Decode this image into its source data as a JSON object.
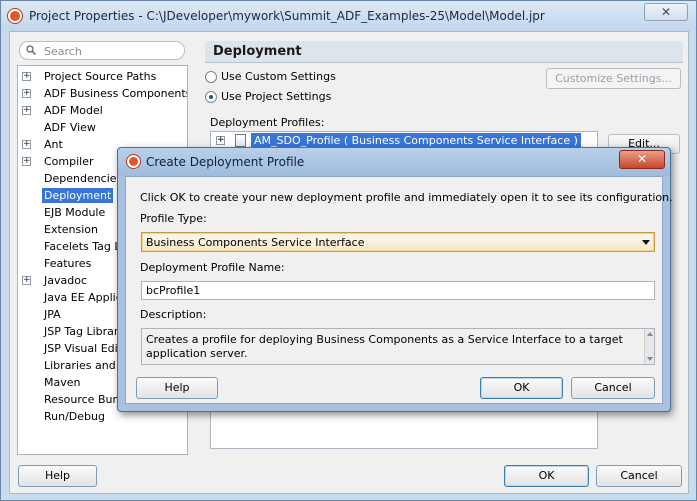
{
  "window": {
    "title": "Project Properties - C:\\JDeveloper\\mywork\\Summit_ADF_Examples-25\\Model\\Model.jpr",
    "close_label": "✕"
  },
  "search": {
    "placeholder": "Search"
  },
  "tree": {
    "items": [
      {
        "label": "Project Source Paths",
        "expandable": true
      },
      {
        "label": "ADF Business Components",
        "expandable": true
      },
      {
        "label": "ADF Model",
        "expandable": true
      },
      {
        "label": "ADF View",
        "expandable": false
      },
      {
        "label": "Ant",
        "expandable": true
      },
      {
        "label": "Compiler",
        "expandable": true
      },
      {
        "label": "Dependencies",
        "expandable": false
      },
      {
        "label": "Deployment",
        "expandable": false,
        "selected": true
      },
      {
        "label": "EJB Module",
        "expandable": false
      },
      {
        "label": "Extension",
        "expandable": false
      },
      {
        "label": "Facelets Tag Libr",
        "expandable": false
      },
      {
        "label": "Features",
        "expandable": false
      },
      {
        "label": "Javadoc",
        "expandable": true
      },
      {
        "label": "Java EE Applicati",
        "expandable": false
      },
      {
        "label": "JPA",
        "expandable": false
      },
      {
        "label": "JSP Tag Libraries",
        "expandable": false
      },
      {
        "label": "JSP Visual Editor",
        "expandable": false
      },
      {
        "label": "Libraries and Cla",
        "expandable": false
      },
      {
        "label": "Maven",
        "expandable": false
      },
      {
        "label": "Resource Bundle",
        "expandable": false
      },
      {
        "label": "Run/Debug",
        "expandable": false
      }
    ]
  },
  "panel": {
    "title": "Deployment",
    "radio_custom": "Use Custom Settings",
    "radio_project": "Use Project Settings",
    "customize_button": "Customize Settings...",
    "profiles_label": "Deployment Profiles:",
    "profile_item": "AM_SDO_Profile ( Business Components Service Interface )",
    "edit_button": "Edit...",
    "selected_setting": "Use Project Settings"
  },
  "footer": {
    "help": "Help",
    "ok": "OK",
    "cancel": "Cancel"
  },
  "dialog": {
    "title": "Create Deployment Profile",
    "close_label": "✕",
    "intro": "Click OK to create your new deployment profile and immediately open it to see its configuration.",
    "profile_type_label": "Profile Type:",
    "profile_type_value": "Business Components Service Interface",
    "name_label": "Deployment Profile Name:",
    "name_value": "bcProfile1",
    "description_label": "Description:",
    "description_text": "Creates a profile for deploying Business Components as a Service Interface to a target application server.",
    "help": "Help",
    "ok": "OK",
    "cancel": "Cancel"
  }
}
